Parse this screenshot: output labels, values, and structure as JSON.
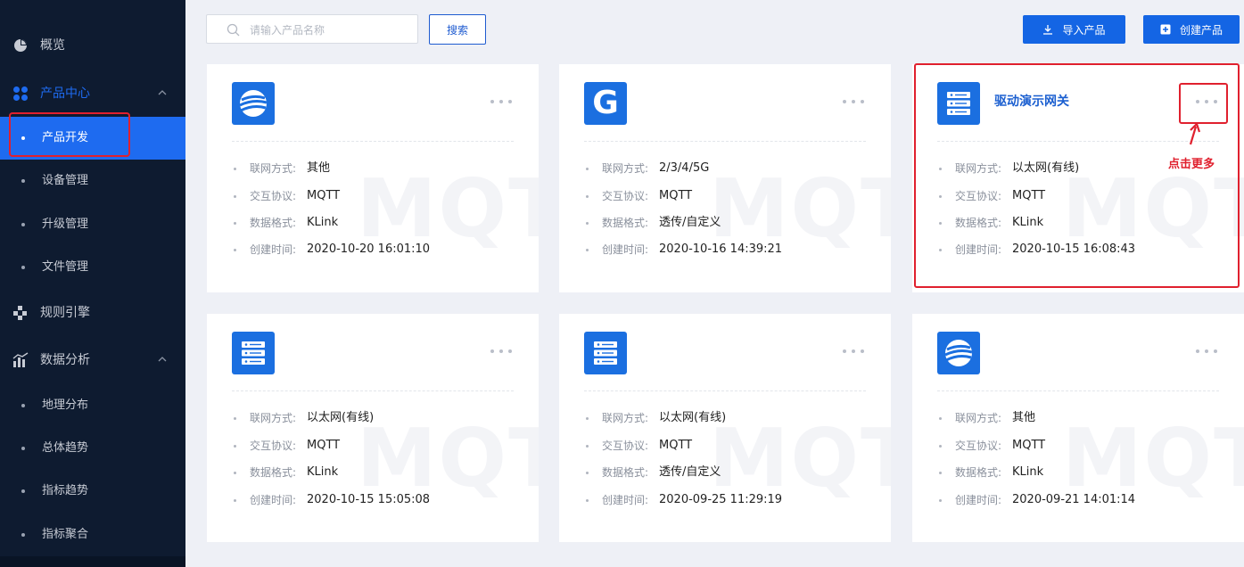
{
  "sidebar": {
    "items": [
      {
        "label": "概览",
        "icon": "pie-chart-icon"
      },
      {
        "label": "产品中心",
        "icon": "grid-icon",
        "expanded": true,
        "active": true,
        "children": [
          {
            "label": "产品开发",
            "selected": true
          },
          {
            "label": "设备管理"
          },
          {
            "label": "升级管理"
          },
          {
            "label": "文件管理"
          }
        ]
      },
      {
        "label": "规则引擎",
        "icon": "rules-icon"
      },
      {
        "label": "数据分析",
        "icon": "bar-chart-icon",
        "expanded": true,
        "children": [
          {
            "label": "地理分布"
          },
          {
            "label": "总体趋势"
          },
          {
            "label": "指标趋势"
          },
          {
            "label": "指标聚合"
          }
        ]
      }
    ]
  },
  "toolbar": {
    "search_placeholder": "请输入产品名称",
    "search_value": "",
    "search_label": "搜索",
    "import_label": "导入产品",
    "create_label": "创建产品"
  },
  "labels": {
    "network": "联网方式:",
    "protocol": "交互协议:",
    "format": "数据格式:",
    "created": "创建时间:"
  },
  "watermark": "MQTT",
  "colors": {
    "accent": "#1465e4",
    "sidebar_bg": "#0e1b30",
    "annotation": "#e0202e"
  },
  "cards": [
    {
      "title": "",
      "icon": "globe-icon",
      "network": "其他",
      "protocol": "MQTT",
      "format": "KLink",
      "created": "2020-10-20 16:01:10"
    },
    {
      "title": "",
      "icon": "g-logo-icon",
      "icon_letter": "G",
      "network": "2/3/4/5G",
      "protocol": "MQTT",
      "format": "透传/自定义",
      "created": "2020-10-16 14:39:21"
    },
    {
      "title": "驱动演示网关",
      "icon": "server-icon",
      "network": "以太网(有线)",
      "protocol": "MQTT",
      "format": "KLink",
      "created": "2020-10-15 16:08:43"
    },
    {
      "title": "",
      "icon": "server-icon",
      "network": "以太网(有线)",
      "protocol": "MQTT",
      "format": "KLink",
      "created": "2020-10-15 15:05:08"
    },
    {
      "title": "",
      "icon": "server-icon",
      "network": "以太网(有线)",
      "protocol": "MQTT",
      "format": "透传/自定义",
      "created": "2020-09-25 11:29:19"
    },
    {
      "title": "",
      "icon": "globe-icon",
      "network": "其他",
      "protocol": "MQTT",
      "format": "KLink",
      "created": "2020-09-21 14:01:14"
    }
  ],
  "annotation": {
    "text": "点击更多"
  }
}
